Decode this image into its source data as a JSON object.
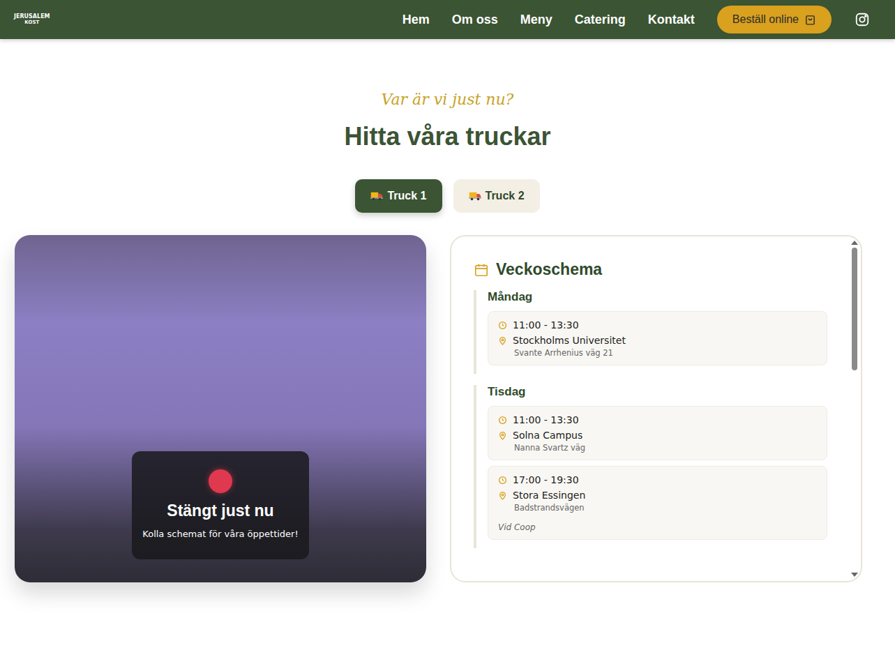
{
  "header": {
    "logo": {
      "line1": "JERUSALEM",
      "line2": "KOST"
    },
    "nav": [
      {
        "label": "Hem"
      },
      {
        "label": "Om oss"
      },
      {
        "label": "Meny"
      },
      {
        "label": "Catering"
      },
      {
        "label": "Kontakt"
      }
    ],
    "order_button": "Beställ online"
  },
  "section": {
    "subtitle": "Var är vi just nu?",
    "title": "Hitta våra truckar"
  },
  "tabs": [
    {
      "label": "Truck 1",
      "selected": true
    },
    {
      "label": "Truck 2",
      "selected": false
    }
  ],
  "status": {
    "open": false,
    "color": "#e0384f",
    "title": "Stängt just nu",
    "text": "Kolla schemat för våra öppettider!"
  },
  "schedule": {
    "title": "Veckoschema",
    "scrollbar": {
      "position": 0,
      "visible_share": 0.38
    },
    "days": [
      {
        "name": "Måndag",
        "slots": [
          {
            "time": "11:00 - 13:30",
            "place": "Stockholms Universitet",
            "address": "Svante Arrhenius väg 21",
            "note": ""
          }
        ]
      },
      {
        "name": "Tisdag",
        "slots": [
          {
            "time": "11:00 - 13:30",
            "place": "Solna Campus",
            "address": "Nanna Svartz väg",
            "note": ""
          },
          {
            "time": "17:00 - 19:30",
            "place": "Stora Essingen",
            "address": "Badstrandsvägen",
            "note": "Vid Coop"
          }
        ]
      }
    ]
  }
}
